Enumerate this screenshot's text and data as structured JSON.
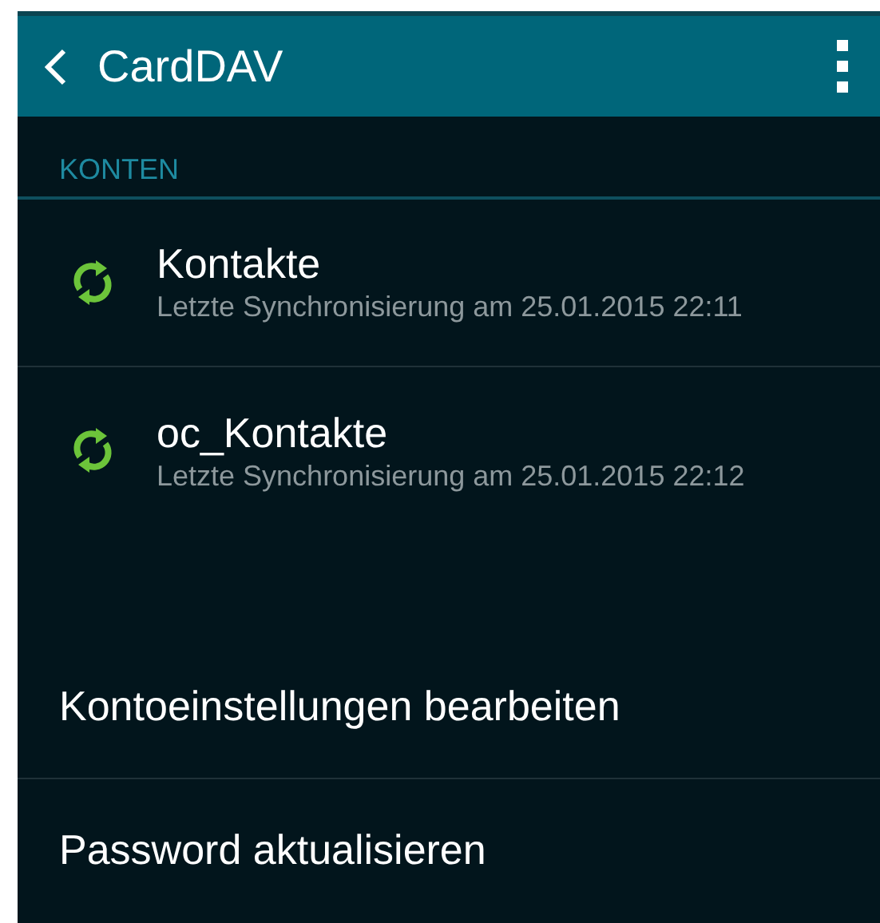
{
  "header": {
    "title": "CardDAV"
  },
  "section": {
    "title": "KONTEN"
  },
  "accounts": [
    {
      "name": "Kontakte",
      "status": "Letzte Synchronisierung am 25.01.2015 22:11"
    },
    {
      "name": "oc_Kontakte",
      "status": "Letzte Synchronisierung am 25.01.2015 22:12"
    }
  ],
  "actions": [
    "Kontoeinstellungen bearbeiten",
    "Password aktualisieren"
  ]
}
